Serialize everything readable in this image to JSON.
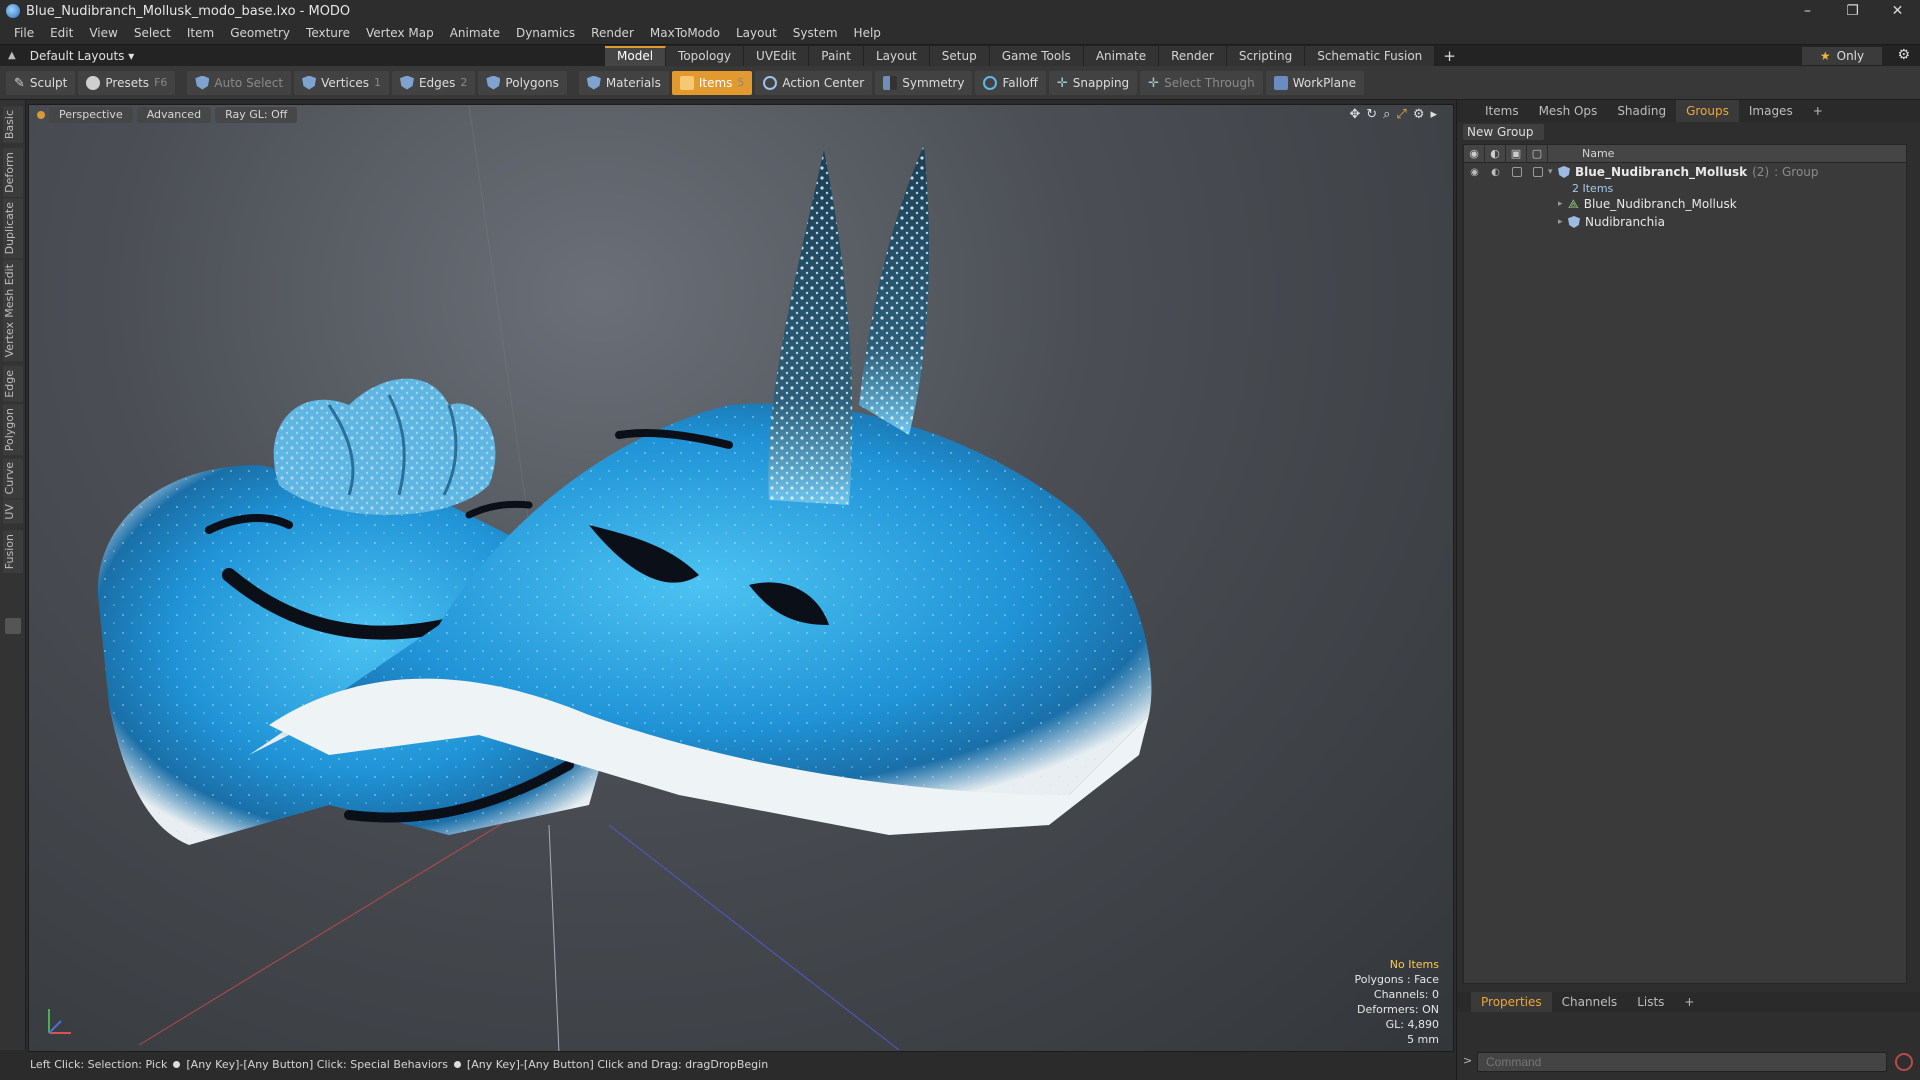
{
  "window": {
    "title": "Blue_Nudibranch_Mollusk_modo_base.lxo - MODO",
    "controls": [
      "–",
      "❐",
      "✕"
    ]
  },
  "menu": [
    "File",
    "Edit",
    "View",
    "Select",
    "Item",
    "Geometry",
    "Texture",
    "Vertex Map",
    "Animate",
    "Dynamics",
    "Render",
    "MaxToModo",
    "Layout",
    "System",
    "Help"
  ],
  "layout_bar": {
    "selector": "Default Layouts ▾",
    "tabs": [
      "Model",
      "Topology",
      "UVEdit",
      "Paint",
      "Layout",
      "Setup",
      "Game Tools",
      "Animate",
      "Render",
      "Scripting",
      "Schematic Fusion"
    ],
    "active_tab": "Model",
    "plus": "+",
    "only_label": "Only"
  },
  "toolbar": {
    "sculpt": "Sculpt",
    "presets": "Presets",
    "presets_key": "F6",
    "auto_select": "Auto Select",
    "vertices": "Vertices",
    "vertices_key": "1",
    "edges": "Edges",
    "edges_key": "2",
    "polygons": "Polygons",
    "materials": "Materials",
    "items": "Items",
    "items_key": "5",
    "action_center": "Action Center",
    "symmetry": "Symmetry",
    "falloff": "Falloff",
    "snapping": "Snapping",
    "select_through": "Select Through",
    "workplane": "WorkPlane"
  },
  "left_tabs": [
    "Basic",
    "Deform",
    "Duplicate",
    "Mesh Edit",
    "Vertex",
    "Edge",
    "Polygon",
    "Curve",
    "UV",
    "Fusion"
  ],
  "viewport": {
    "view": "Perspective",
    "shading": "Advanced",
    "raygl": "Ray GL: Off",
    "info": {
      "no_items": "No Items",
      "polygons": "Polygons : Face",
      "channels": "Channels: 0",
      "deformers": "Deformers: ON",
      "gl": "GL: 4,890",
      "unit": "5 mm"
    }
  },
  "statusbar": {
    "s1": "Left Click: Selection: Pick",
    "s2": "[Any Key]-[Any Button] Click: Special Behaviors",
    "s3": "[Any Key]-[Any Button] Click and Drag: dragDropBegin"
  },
  "right_panel": {
    "tabs": [
      "Items",
      "Mesh Ops",
      "Shading",
      "Groups",
      "Images"
    ],
    "active_tab": "Groups",
    "plus": "+",
    "new_group": "New Group",
    "column_name": "Name",
    "tree": {
      "group_name": "Blue_Nudibranch_Mollusk",
      "group_count": "(2)",
      "group_type": ": Group",
      "group_sub": "2 Items",
      "children": [
        "Blue_Nudibranch_Mollusk",
        "Nudibranchia"
      ]
    },
    "bottom_tabs": [
      "Properties",
      "Channels",
      "Lists"
    ],
    "bottom_active": "Properties",
    "command_placeholder": "Command"
  },
  "colors": {
    "accent": "#e29a2e",
    "mollusk_blue": "#2fa3e0",
    "mollusk_rim": "#e6ecef"
  }
}
